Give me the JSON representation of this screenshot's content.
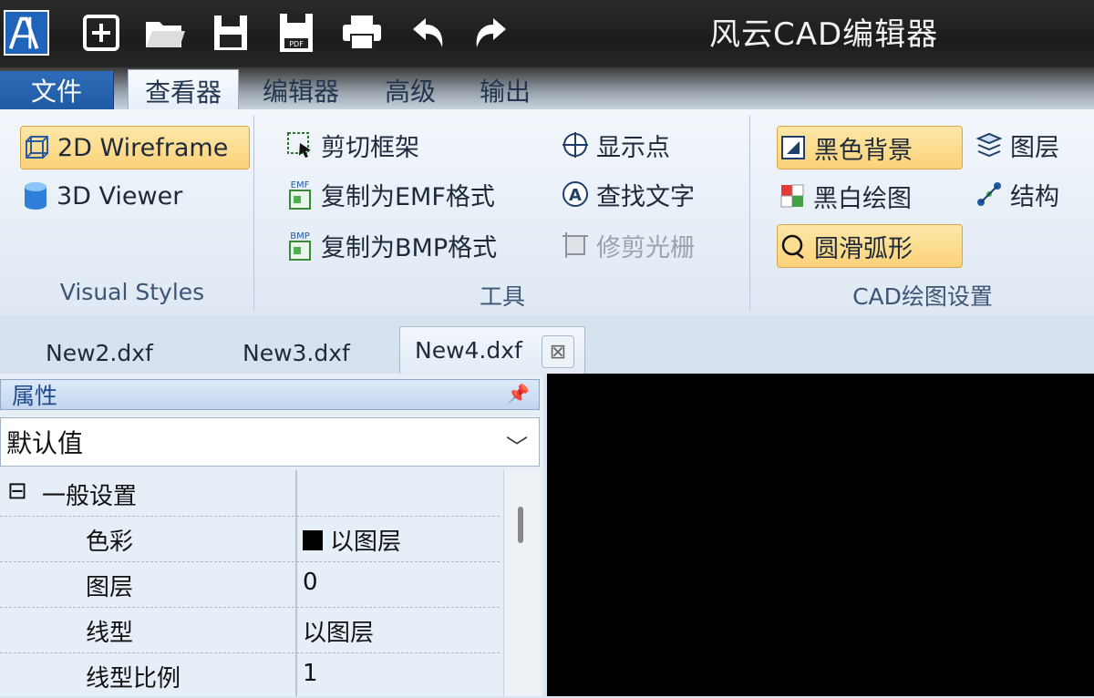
{
  "app": {
    "title": "风云CAD编辑器"
  },
  "quick_access": [
    "logo-icon",
    "new-icon",
    "open-icon",
    "save-icon",
    "save-pdf-icon",
    "print-icon",
    "undo-icon",
    "redo-icon"
  ],
  "ribbon_tabs": {
    "file": "文件",
    "viewer": "查看器",
    "editor": "编辑器",
    "advanced": "高级",
    "output": "输出"
  },
  "groups": {
    "visual_styles": {
      "label": "Visual Styles",
      "wireframe": "2D Wireframe",
      "viewer3d": "3D Viewer"
    },
    "tools": {
      "label": "工具",
      "clip_frame": "剪切框架",
      "copy_emf": "复制为EMF格式",
      "copy_bmp": "复制为BMP格式",
      "show_points": "显示点",
      "find_text": "查找文字",
      "trim_raster": "修剪光栅",
      "emf_tag": "EMF",
      "bmp_tag": "BMP"
    },
    "cad_settings": {
      "label": "CAD绘图设置",
      "black_bg": "黑色背景",
      "bw_drawing": "黑白绘图",
      "smooth_arc": "圆滑弧形",
      "layers": "图层",
      "structure": "结构"
    }
  },
  "doc_tabs": [
    "New2.dxf",
    "New3.dxf",
    "New4.dxf"
  ],
  "properties": {
    "title": "属性",
    "dropdown_value": "默认值",
    "section": "一般设置",
    "section_toggle": "⊟",
    "rows": [
      {
        "name": "色彩",
        "value": "以图层"
      },
      {
        "name": "图层",
        "value": "0"
      },
      {
        "name": "线型",
        "value": "以图层"
      },
      {
        "name": "线型比例",
        "value": "1"
      }
    ]
  },
  "colors": {
    "accent": "#fbd27a",
    "file_tab": "#1f5aa6",
    "canvas": "#000000"
  }
}
